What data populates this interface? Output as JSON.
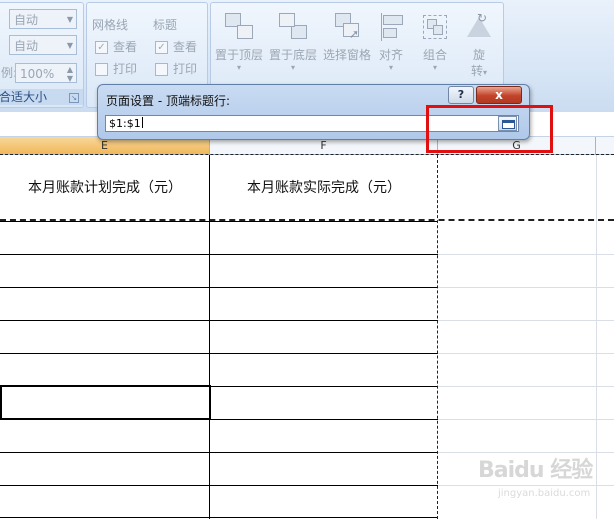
{
  "ribbon": {
    "scale": {
      "width_value": "自动",
      "height_value": "自动",
      "scale_label": "例:",
      "scale_value": "100%",
      "group_label": "合适大小"
    },
    "sheet_options": {
      "gridlines_title": "网格线",
      "headings_title": "标题",
      "view_label": "查看",
      "print_label": "打印",
      "headings_view_label": "查看",
      "headings_print_label": "打印",
      "gridlines_view_checked": true,
      "gridlines_print_checked": false,
      "headings_view_checked": true,
      "headings_print_checked": false
    },
    "arrange": {
      "bring_forward": "置于顶层",
      "send_backward": "置于底层",
      "selection_pane": "选择窗格",
      "align": "对齐",
      "group": "组合",
      "rotate_line1": "旋",
      "rotate_line2": "转"
    }
  },
  "dialog": {
    "title": "页面设置 - 顶端标题行:",
    "help_label": "?",
    "close_label": "x",
    "input_value": "$1:$1"
  },
  "grid": {
    "columns": [
      "E",
      "F",
      "G"
    ],
    "header_cells": [
      "本月账款计划完成（元）",
      "本月账款实际完成（元）"
    ]
  },
  "watermark": {
    "text": "Baidu 经验",
    "url": "jingyan.baidu.com"
  },
  "colors": {
    "highlight": "#e01010",
    "selected_column_header": "#f1b75a",
    "ribbon_background": "#d5e4f5"
  }
}
